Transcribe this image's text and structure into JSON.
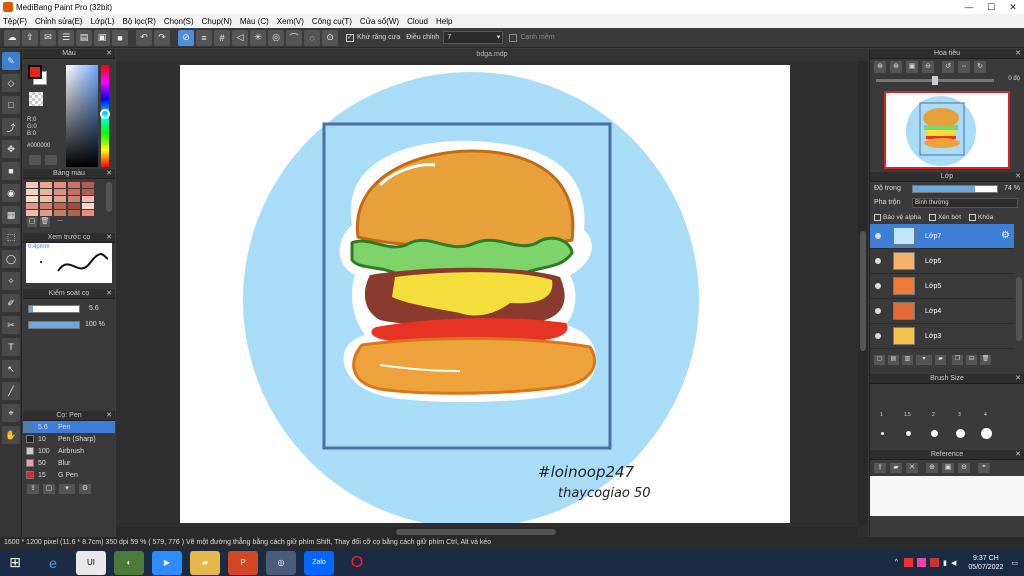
{
  "window": {
    "title": "MediBang Paint Pro (32bit)",
    "controls": [
      "—",
      "☐",
      "✕"
    ]
  },
  "menu": [
    "Tệp(F)",
    "Chỉnh sửa(E)",
    "Lớp(L)",
    "Bộ lọc(R)",
    "Chọn(S)",
    "Chụp(N)",
    "Màu (C)",
    "Xem(V)",
    "Công cụ(T)",
    "Cửa sổ(W)",
    "Cloud",
    "Help"
  ],
  "toolbar": {
    "antialias_label": "Khử răng cưa",
    "adjust_label": "Điều chỉnh",
    "adjust_value": "7",
    "snap_label": "Cạnh mềm"
  },
  "color_panel": {
    "title": "Màu",
    "r": "R:0",
    "g": "G:0",
    "b": "B:0",
    "hex": "#000000",
    "primary": "#e6231c",
    "secondary": "#ffffff"
  },
  "palette_panel": {
    "title": "Bảng màu",
    "more": "---",
    "swatches": [
      "#f6c6b4",
      "#f3a38d",
      "#e8887a",
      "#d06e62",
      "#b95b4f",
      "#f2d5c8",
      "#e9b6a6",
      "#dc8f86",
      "#c77062",
      "#b45c4e",
      "#f8e0d0",
      "#edbfa8",
      "#e0a08c",
      "#c88470",
      "#f5b8b0",
      "#e8938a",
      "#d87a6c",
      "#bd6153",
      "#a8493d",
      "#fcd9cc",
      "#f0bca9",
      "#df9c88",
      "#c47f6c",
      "#ad6554",
      "#ec8c7d"
    ]
  },
  "preview_panel": {
    "title": "Xem trước cọ",
    "size": "0.4pmm"
  },
  "brush_control": {
    "title": "Kiểm soát cọ",
    "size": "5.6",
    "opacity": "100 %"
  },
  "brush_list": {
    "title": "Cọ: Pen",
    "items": [
      {
        "size": "5.6",
        "name": "Pen",
        "color": "#3d7fd6",
        "selected": true
      },
      {
        "size": "10",
        "name": "Pen (Sharp)",
        "color": "#222222",
        "selected": false
      },
      {
        "size": "100",
        "name": "Airbrush",
        "color": "#cccccc",
        "selected": false
      },
      {
        "size": "50",
        "name": "Blur",
        "color": "#f29bb8",
        "selected": false
      },
      {
        "size": "15",
        "name": "G Pen",
        "color": "#e6231c",
        "selected": false
      }
    ]
  },
  "canvas": {
    "document_tab": "bdga.mdp",
    "signature_line1": "#loinoop247",
    "signature_line2": "thaycogiao 50"
  },
  "navigator": {
    "title": "Hoa tiêu",
    "rotation": "0 độ"
  },
  "layer_panel": {
    "title": "Lớp",
    "opacity_label": "Độ trong",
    "opacity_value": "74 %",
    "opacity": 0.74,
    "blend_label": "Pha trộn",
    "blend_value": "Bình thường",
    "protect_alpha": "Bảo vệ alpha",
    "clip": "Xén bớt",
    "lock": "Khóa",
    "layers": [
      {
        "name": "Lớp7",
        "selected": true
      },
      {
        "name": "Lớp6",
        "selected": false
      },
      {
        "name": "Lớp5",
        "selected": false
      },
      {
        "name": "Lớp4",
        "selected": false
      },
      {
        "name": "Lớp3",
        "selected": false
      }
    ]
  },
  "brush_size_panel": {
    "title": "Brush Size",
    "labels": [
      "1",
      "1.5",
      "2",
      "3",
      "4"
    ]
  },
  "reference_panel": {
    "title": "Reference"
  },
  "status": {
    "text": "1600 * 1200 pixel  (11.6 * 8.7cm)  350 dpi   59 %   ( 579, 776 )  Vẽ một đường thẳng bằng cách giữ phím Shift, Thay đổi cỡ cọ bằng cách giữ phím Ctrl, Alt và kéo"
  },
  "taskbar": {
    "time": "9:37 CH",
    "date": "05/07/2022",
    "apps": [
      "Zalo"
    ]
  }
}
